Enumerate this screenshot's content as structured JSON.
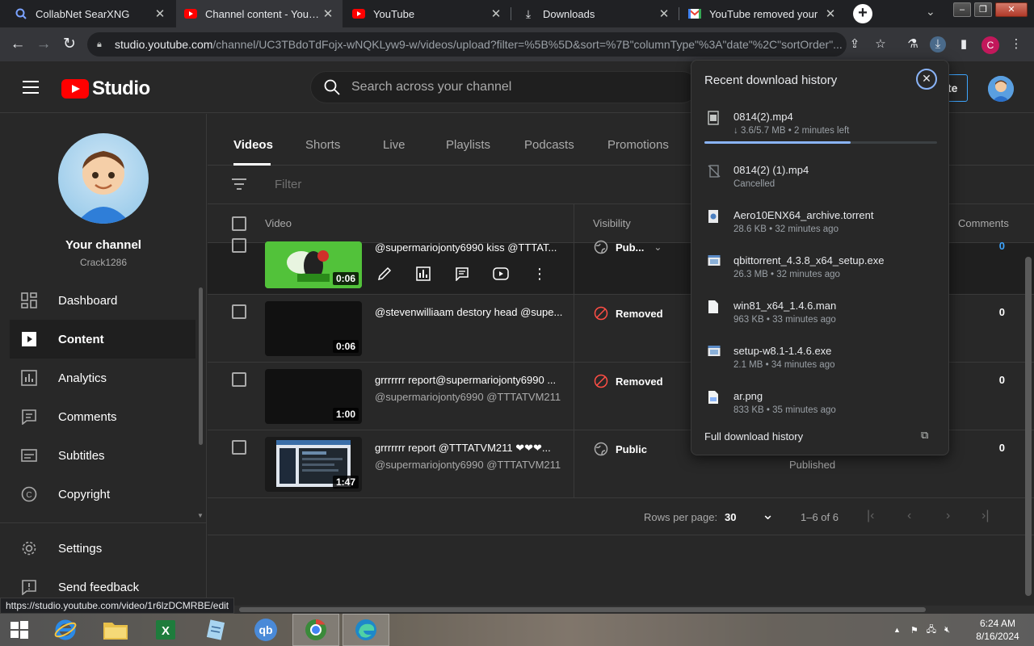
{
  "browser": {
    "tabs": [
      {
        "title": "CollabNet SearXNG",
        "active": false
      },
      {
        "title": "Channel content - YouTube",
        "active": true
      },
      {
        "title": "YouTube",
        "active": false
      },
      {
        "title": "Downloads",
        "active": false
      },
      {
        "title": "YouTube removed your",
        "active": false
      }
    ],
    "address_host": "studio.youtube.com",
    "address_path": "/channel/UC3TBdoTdFojx-wNQKLyw9-w/videos/upload?filter=%5B%5D&sort=%7B\"columnType\"%3A\"date\"%2C\"sortOrder\"...",
    "profile_initial": "C",
    "status_url": "https://studio.youtube.com/video/1r6lzDCMRBE/edit"
  },
  "studio": {
    "logo_text": "Studio",
    "search_placeholder": "Search across your channel",
    "create_label": "te"
  },
  "sidebar": {
    "channel_title": "Your channel",
    "channel_handle": "Crack1286",
    "items": [
      {
        "label": "Dashboard",
        "icon": "dashboard-icon"
      },
      {
        "label": "Content",
        "icon": "content-icon",
        "active": true
      },
      {
        "label": "Analytics",
        "icon": "analytics-icon"
      },
      {
        "label": "Comments",
        "icon": "comments-icon"
      },
      {
        "label": "Subtitles",
        "icon": "subtitles-icon"
      },
      {
        "label": "Copyright",
        "icon": "copyright-icon"
      }
    ],
    "footer": [
      {
        "label": "Settings",
        "icon": "gear-icon"
      },
      {
        "label": "Send feedback",
        "icon": "feedback-icon"
      }
    ]
  },
  "content": {
    "tabs": [
      "Videos",
      "Shorts",
      "Live",
      "Playlists",
      "Podcasts",
      "Promotions"
    ],
    "filter_placeholder": "Filter",
    "columns": {
      "video": "Video",
      "visibility": "Visibility",
      "comments": "Comments"
    },
    "rows": [
      {
        "title": "@supermariojonty6990 kiss @TTTAT...",
        "desc": "",
        "duration": "0:06",
        "visibility": "Pub...",
        "status": "",
        "comments": "0"
      },
      {
        "title": "@stevenwilliaam destory head @supe...",
        "desc": "",
        "duration": "0:06",
        "visibility": "Removed",
        "status": "",
        "comments": "0"
      },
      {
        "title": "grrrrrrr report@supermariojonty6990 ...",
        "desc": "@supermariojonty6990 @TTTATVM211",
        "duration": "1:00",
        "visibility": "Removed",
        "status": "",
        "comments": "0"
      },
      {
        "title": "grrrrrrr report @TTTATVM211 ❤❤❤...",
        "desc": "@supermariojonty6990 @TTTATVM211",
        "duration": "1:47",
        "visibility": "Public",
        "status": "Published",
        "comments": "0"
      }
    ],
    "pager": {
      "rows_label": "Rows per page:",
      "rows_value": "30",
      "range": "1–6 of 6"
    }
  },
  "downloads": {
    "title": "Recent download history",
    "items": [
      {
        "name": "0814(2).mp4",
        "meta": "↓ 3.6/5.7 MB • 2 minutes left",
        "progress": 0.63,
        "icon": "file-video-icon"
      },
      {
        "name": "0814(2) (1).mp4",
        "meta": "Cancelled",
        "icon": "file-cancelled-icon"
      },
      {
        "name": "Aero10ENX64_archive.torrent",
        "meta": "28.6 KB • 32 minutes ago",
        "icon": "file-torrent-icon"
      },
      {
        "name": "qbittorrent_4.3.8_x64_setup.exe",
        "meta": "26.3 MB • 32 minutes ago",
        "icon": "file-exe-icon"
      },
      {
        "name": "win81_x64_1.4.6.man",
        "meta": "963 KB • 33 minutes ago",
        "icon": "file-generic-icon"
      },
      {
        "name": "setup-w8.1-1.4.6.exe",
        "meta": "2.1 MB • 34 minutes ago",
        "icon": "file-exe-icon"
      },
      {
        "name": "ar.png",
        "meta": "833 KB • 35 minutes ago",
        "icon": "file-image-icon"
      }
    ],
    "full_history": "Full download history"
  },
  "taskbar": {
    "time": "6:24 AM",
    "date": "8/16/2024"
  }
}
